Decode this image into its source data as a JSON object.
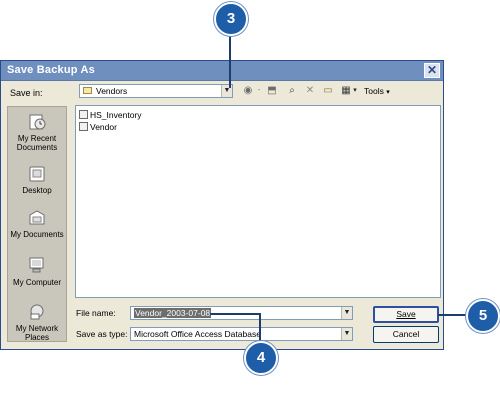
{
  "dialog": {
    "title": "Save Backup As"
  },
  "top": {
    "save_in_label": "Save in:",
    "save_in_value": "Vendors",
    "tools_label": "Tools"
  },
  "places": [
    {
      "label": "My Recent Documents",
      "icon": "recent-docs-icon"
    },
    {
      "label": "Desktop",
      "icon": "desktop-icon"
    },
    {
      "label": "My Documents",
      "icon": "my-documents-icon"
    },
    {
      "label": "My Computer",
      "icon": "my-computer-icon"
    },
    {
      "label": "My Network Places",
      "icon": "network-places-icon"
    }
  ],
  "files": [
    {
      "name": "HS_Inventory"
    },
    {
      "name": "Vendor"
    }
  ],
  "bottom": {
    "file_name_label": "File name:",
    "file_name_value": "Vendor_2003-07-08",
    "save_as_type_label": "Save as type:",
    "save_as_type_value": "Microsoft Office Access Database",
    "save_button": "Save",
    "cancel_button": "Cancel"
  },
  "callouts": {
    "c3": "3",
    "c4": "4",
    "c5": "5"
  },
  "colors": {
    "titlebar": "#6f8fbf",
    "dialog_bg": "#ece9d8",
    "callout": "#1e5ea8"
  }
}
